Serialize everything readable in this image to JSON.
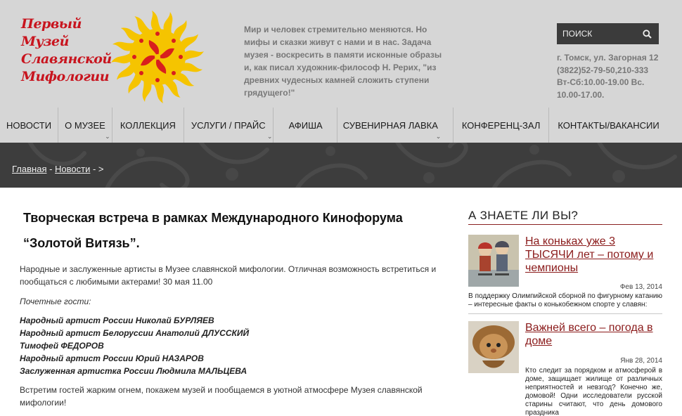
{
  "logo": {
    "lines": [
      "Первый",
      "Музей",
      "Славянской",
      "Мифологии"
    ]
  },
  "header": {
    "tagline": "Мир и человек стремительно меняются. Но мифы и сказки живут с нами и в нас. Задача музея - воскресить в памяти исконные образы и, как писал художник-философ Н. Рерих, \"из древних чудесных камней сложить ступени грядущего!\"",
    "search_placeholder": "ПОИСК",
    "contacts": [
      "г. Томск, ул. Загорная 12",
      "(3822)52-79-50,210-333",
      "Вт-Сб:10.00-19.00 Вс.",
      "10.00-17.00."
    ]
  },
  "nav": [
    {
      "label": "Новости",
      "dropdown": false
    },
    {
      "label": "О музее",
      "dropdown": true
    },
    {
      "label": "Коллекция",
      "dropdown": false
    },
    {
      "label": "Услуги / прайс",
      "dropdown": true
    },
    {
      "label": "Афиша",
      "dropdown": false
    },
    {
      "label": "Сувенирная лавка",
      "dropdown": true
    },
    {
      "label": "Конференц-зал",
      "dropdown": false
    },
    {
      "label": "Контакты/вакансии",
      "dropdown": false
    }
  ],
  "breadcrumb": {
    "home": "Главная",
    "sep1": " - ",
    "news": "Новости",
    "sep2": " - >"
  },
  "article": {
    "title": "Творческая встреча в рамках Международного Кинофорума “Золотой Витязь”.",
    "intro": "Народные и заслуженные артисты в Музее славянской мифологии. Отличная возможность встретиться и пообщаться с любимыми актерами! 30 мая 11.00",
    "guests_heading": "Почетные гости:",
    "guests": [
      "Народный артист России Николай БУРЛЯЕВ",
      "Народный артист Белоруссии Анатолий ДЛУССКИЙ",
      "Тимофей ФЕДОРОВ",
      "Народный артист России Юрий НАЗАРОВ",
      "Заслуженная артистка России Людмила МАЛЬЦЕВА"
    ],
    "outro": "Встретим гостей жарким огнем, покажем музей и пообщаемся в уютной атмосфере Музея славянской мифологии!"
  },
  "sidebar": {
    "heading": "А знаете ли вы?",
    "cards": [
      {
        "title": "На коньках уже 3 ТЫСЯЧИ лет – потому и чемпионы",
        "date": "Фев 13, 2014",
        "desc": "В поддержку Олимпийской сборной по фигурному катанию – интересные факты о конькобежном спорте у славян:"
      },
      {
        "title": "Важней всего – погода в доме",
        "date": "Янв 28, 2014",
        "desc": "Кто следит за порядком и атмосферой в доме, защищает жилище от различных неприятностей и невзгод? Конечно же, домовой! Одни исследователи русской старины считают, что день домового праздника"
      }
    ]
  },
  "colors": {
    "header_bg": "#d6d6d6",
    "logo_red": "#c8141e",
    "accent_dark_red": "#8a1a1a",
    "band_bg": "#3d3d3d",
    "sun_yellow": "#f5c400"
  }
}
